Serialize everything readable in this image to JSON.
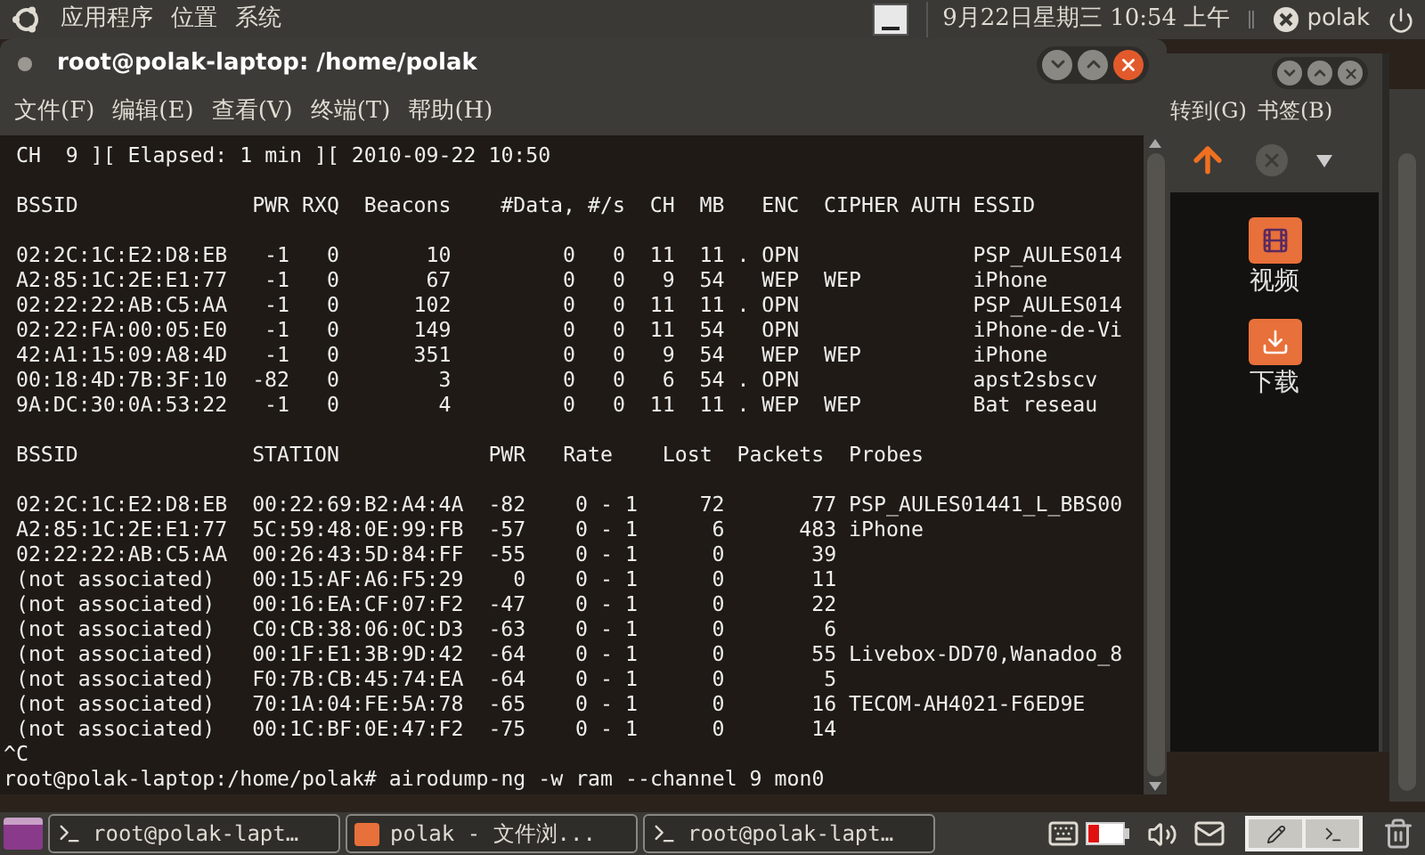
{
  "top_panel": {
    "menus": [
      "应用程序",
      "位置",
      "系统"
    ],
    "datetime": "9月22日星期三 10:54 上午",
    "user": "polak"
  },
  "terminal": {
    "title": "root@polak-laptop: /home/polak",
    "menu": [
      "文件(F)",
      "编辑(E)",
      "查看(V)",
      "终端(T)",
      "帮助(H)"
    ],
    "status_line": "CH  9 ][ Elapsed: 1 min ][ 2010-09-22 10:50",
    "ap_table": {
      "columns": [
        "BSSID",
        "PWR",
        "RXQ",
        "Beacons",
        "#Data,",
        "#/s",
        "CH",
        "MB",
        "ENC",
        "CIPHER",
        "AUTH",
        "ESSID"
      ],
      "rows": [
        [
          "02:2C:1C:E2:D8:EB",
          "-1",
          "0",
          "10",
          "0",
          "0",
          "11",
          "11 .",
          "OPN",
          null,
          null,
          "PSP_AULES014"
        ],
        [
          "A2:85:1C:2E:E1:77",
          "-1",
          "0",
          "67",
          "0",
          "0",
          "9",
          "54",
          "WEP",
          "WEP",
          null,
          "iPhone"
        ],
        [
          "02:22:22:AB:C5:AA",
          "-1",
          "0",
          "102",
          "0",
          "0",
          "11",
          "11 .",
          "OPN",
          null,
          null,
          "PSP_AULES014"
        ],
        [
          "02:22:FA:00:05:E0",
          "-1",
          "0",
          "149",
          "0",
          "0",
          "11",
          "54",
          "OPN",
          null,
          null,
          "iPhone-de-Vi"
        ],
        [
          "42:A1:15:09:A8:4D",
          "-1",
          "0",
          "351",
          "0",
          "0",
          "9",
          "54",
          "WEP",
          "WEP",
          null,
          "iPhone"
        ],
        [
          "00:18:4D:7B:3F:10",
          "-82",
          "0",
          "3",
          "0",
          "0",
          "6",
          "54 .",
          "OPN",
          null,
          null,
          "apst2sbscv"
        ],
        [
          "9A:DC:30:0A:53:22",
          "-1",
          "0",
          "4",
          "0",
          "0",
          "11",
          "11 .",
          "WEP",
          "WEP",
          null,
          "Bat reseau"
        ]
      ]
    },
    "station_table": {
      "columns": [
        "BSSID",
        "STATION",
        "PWR",
        "Rate",
        "Lost",
        "Packets",
        "Probes"
      ],
      "rows": [
        [
          "02:2C:1C:E2:D8:EB",
          "00:22:69:B2:A4:4A",
          "-82",
          "0 - 1",
          "72",
          "77",
          "PSP_AULES01441_L_BBS00"
        ],
        [
          "A2:85:1C:2E:E1:77",
          "5C:59:48:0E:99:FB",
          "-57",
          "0 - 1",
          "6",
          "483",
          "iPhone"
        ],
        [
          "02:22:22:AB:C5:AA",
          "00:26:43:5D:84:FF",
          "-55",
          "0 - 1",
          "0",
          "39",
          null
        ],
        [
          "(not associated)",
          "00:15:AF:A6:F5:29",
          "0",
          "0 - 1",
          "0",
          "11",
          null
        ],
        [
          "(not associated)",
          "00:16:EA:CF:07:F2",
          "-47",
          "0 - 1",
          "0",
          "22",
          null
        ],
        [
          "(not associated)",
          "C0:CB:38:06:0C:D3",
          "-63",
          "0 - 1",
          "0",
          "6",
          null
        ],
        [
          "(not associated)",
          "00:1F:E1:3B:9D:42",
          "-64",
          "0 - 1",
          "0",
          "55",
          "Livebox-DD70,Wanadoo_8"
        ],
        [
          "(not associated)",
          "F0:7B:CB:45:74:EA",
          "-64",
          "0 - 1",
          "0",
          "5",
          null
        ],
        [
          "(not associated)",
          "70:1A:04:FE:5A:78",
          "-65",
          "0 - 1",
          "0",
          "16",
          "TECOM-AH4021-F6ED9E"
        ],
        [
          "(not associated)",
          "00:1C:BF:0E:47:F2",
          "-75",
          "0 - 1",
          "0",
          "14",
          null
        ]
      ]
    },
    "lines": [
      "^C",
      "root@polak-laptop:/home/polak# airodump-ng -w ram --channel 9 mon0"
    ]
  },
  "file_manager": {
    "menu": [
      "转到(G)",
      "书签(B)"
    ],
    "folders": [
      {
        "label": "视频",
        "kind": "video"
      },
      {
        "label": "下载",
        "kind": "download"
      }
    ]
  },
  "taskbar": {
    "tasks": [
      {
        "label": "root@polak-lapt…",
        "kind": "terminal",
        "selected": false
      },
      {
        "label": "polak - 文件浏...",
        "kind": "files",
        "selected": false
      },
      {
        "label": "root@polak-lapt…",
        "kind": "terminal",
        "selected": false
      }
    ]
  }
}
